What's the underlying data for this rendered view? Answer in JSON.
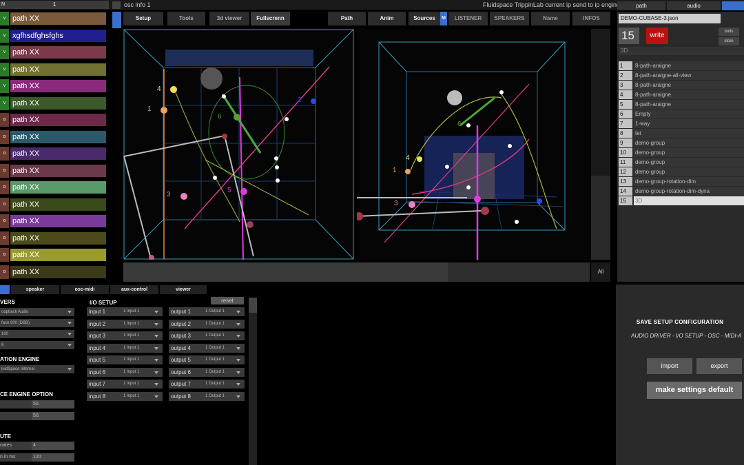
{
  "topbar": {
    "left_number": "1",
    "left_flag": "N",
    "osc_info": "osc info 1",
    "ip_text": "Fluidspace TrippinLab current ip send to ip engine"
  },
  "sources": [
    {
      "tag": "v",
      "label": "path XX",
      "color": "#7a5a3a",
      "btn": "#2a7a2a"
    },
    {
      "tag": "v",
      "label": "xgfhsdfghsfghs",
      "color": "#1f1f90",
      "btn": "#2a7a2a"
    },
    {
      "tag": "v",
      "label": "path XX",
      "color": "#7a3a4a",
      "btn": "#2a7a2a"
    },
    {
      "tag": "v",
      "label": "path XX",
      "color": "#707030",
      "btn": "#2a7a2a"
    },
    {
      "tag": "v",
      "label": "path XX",
      "color": "#8a2a7a",
      "btn": "#2a7a2a"
    },
    {
      "tag": "v",
      "label": "path XX",
      "color": "#3a5a2a",
      "btn": "#2a7a2a"
    },
    {
      "tag": "o",
      "label": "path XX",
      "color": "#6a2a4a",
      "btn": "#6a3a30"
    },
    {
      "tag": "o",
      "label": "path XX",
      "color": "#2a5a6a",
      "btn": "#6a3a30"
    },
    {
      "tag": "o",
      "label": "path XX",
      "color": "#4a2a6a",
      "btn": "#6a3a30"
    },
    {
      "tag": "o",
      "label": "path XX",
      "color": "#6a3a4a",
      "btn": "#6a3a30"
    },
    {
      "tag": "o",
      "label": "path XX",
      "color": "#5a9a6a",
      "btn": "#6a3a30"
    },
    {
      "tag": "o",
      "label": "path XX",
      "color": "#3a4a1a",
      "btn": "#6a3a30"
    },
    {
      "tag": "o",
      "label": "path XX",
      "color": "#7a3a9a",
      "btn": "#6a3a30"
    },
    {
      "tag": "o",
      "label": "path XX",
      "color": "#4a4a1a",
      "btn": "#6a3a30"
    },
    {
      "tag": "o",
      "label": "path XX",
      "color": "#9a9a30",
      "btn": "#6a3a30"
    },
    {
      "tag": "o",
      "label": "path XX",
      "color": "#3a3a1a",
      "btn": "#6a3a30"
    }
  ],
  "toolbar": {
    "setup": "Setup",
    "tools": "Tools",
    "viewer3d": "3d viewer",
    "fullscreen": "Fullscrenn",
    "path": "Path",
    "anim": "Anim",
    "sources": "Sources",
    "m": "M",
    "listener": "LISTENER",
    "speakers": "SPEAKERS",
    "name": "Name",
    "infos": "INFOS"
  },
  "right_panel": {
    "tabs": {
      "path": "path",
      "audio": "audio"
    },
    "file": "DEMO-CUBASE-3.json",
    "current_num": "15",
    "write": "write",
    "tools": "tools",
    "store": "store",
    "current_name": "3D",
    "presets": [
      {
        "n": "1",
        "name": "8-path-araigne"
      },
      {
        "n": "2",
        "name": "8-path-araigne-all-view"
      },
      {
        "n": "3",
        "name": "8-path-araigne"
      },
      {
        "n": "4",
        "name": "8-path-araigne"
      },
      {
        "n": "5",
        "name": "8-path-araigne"
      },
      {
        "n": "6",
        "name": "Empty"
      },
      {
        "n": "7",
        "name": "1-way"
      },
      {
        "n": "8",
        "name": "tet"
      },
      {
        "n": "9",
        "name": "demo-group"
      },
      {
        "n": "10",
        "name": "demo-group"
      },
      {
        "n": "11",
        "name": "demo-group"
      },
      {
        "n": "12",
        "name": "demo-group"
      },
      {
        "n": "13",
        "name": "demo-group-rotation-dim"
      },
      {
        "n": "14",
        "name": "demo-group-rotation-dim-dyna"
      },
      {
        "n": "15",
        "name": "3D"
      }
    ]
  },
  "viewer": {
    "all": "All",
    "left_labels": {
      "l1": "1",
      "l2": "2",
      "l3": "3",
      "l4": "4",
      "l5": "5",
      "l6": "6"
    },
    "right_labels": {
      "l1": "1",
      "l3": "3",
      "l4": "4",
      "l6": "6"
    }
  },
  "bottom_tabs": {
    "speaker": "speaker",
    "osc_midi": "osc-midi",
    "aux": "aux-control",
    "viewer": "viewer"
  },
  "setup": {
    "drivers_head": "VERS",
    "drivers": [
      "oopback Audio",
      "face 800 (DBB)",
      "100",
      "6"
    ],
    "engine_head": "ATION ENGINE",
    "engine": "luidSpace Internal",
    "option_head": "CE ENGINE OPTION",
    "option_values": [
      "50.",
      "50."
    ],
    "compute_head": "UTE",
    "compute": [
      {
        "label": "nates",
        "value": "4"
      },
      {
        "label": "n in ms",
        "value": "120"
      }
    ],
    "io_head": "I/O SETUP",
    "reset": "reset",
    "inputs": [
      {
        "name": "input 1",
        "val": "1 Input 1"
      },
      {
        "name": "input 2",
        "val": "1 Input 1"
      },
      {
        "name": "input 3",
        "val": "1 Input 1"
      },
      {
        "name": "input 4",
        "val": "1 Input 1"
      },
      {
        "name": "input 5",
        "val": "1 Input 1"
      },
      {
        "name": "input 6",
        "val": "1 Input 1"
      },
      {
        "name": "input 7",
        "val": "1 Input 1"
      },
      {
        "name": "input 8",
        "val": "1 Input 1"
      }
    ],
    "outputs": [
      {
        "name": "output 1",
        "val": "1 Output 1"
      },
      {
        "name": "output 2",
        "val": "1 Output 1"
      },
      {
        "name": "output 3",
        "val": "1 Output 1"
      },
      {
        "name": "output 4",
        "val": "1 Output 1"
      },
      {
        "name": "output 5",
        "val": "1 Output 1"
      },
      {
        "name": "output 6",
        "val": "1 Output 1"
      },
      {
        "name": "output 7",
        "val": "1 Output 1"
      },
      {
        "name": "output 8",
        "val": "1 Output 1"
      }
    ]
  },
  "save": {
    "title": "SAVE  SETUP CONFIGURATION",
    "subtitle": "AUDIO DRIVER - I/O SETUP - OSC - MIDI-A",
    "import": "import",
    "export": "export",
    "default": "make settings default"
  }
}
